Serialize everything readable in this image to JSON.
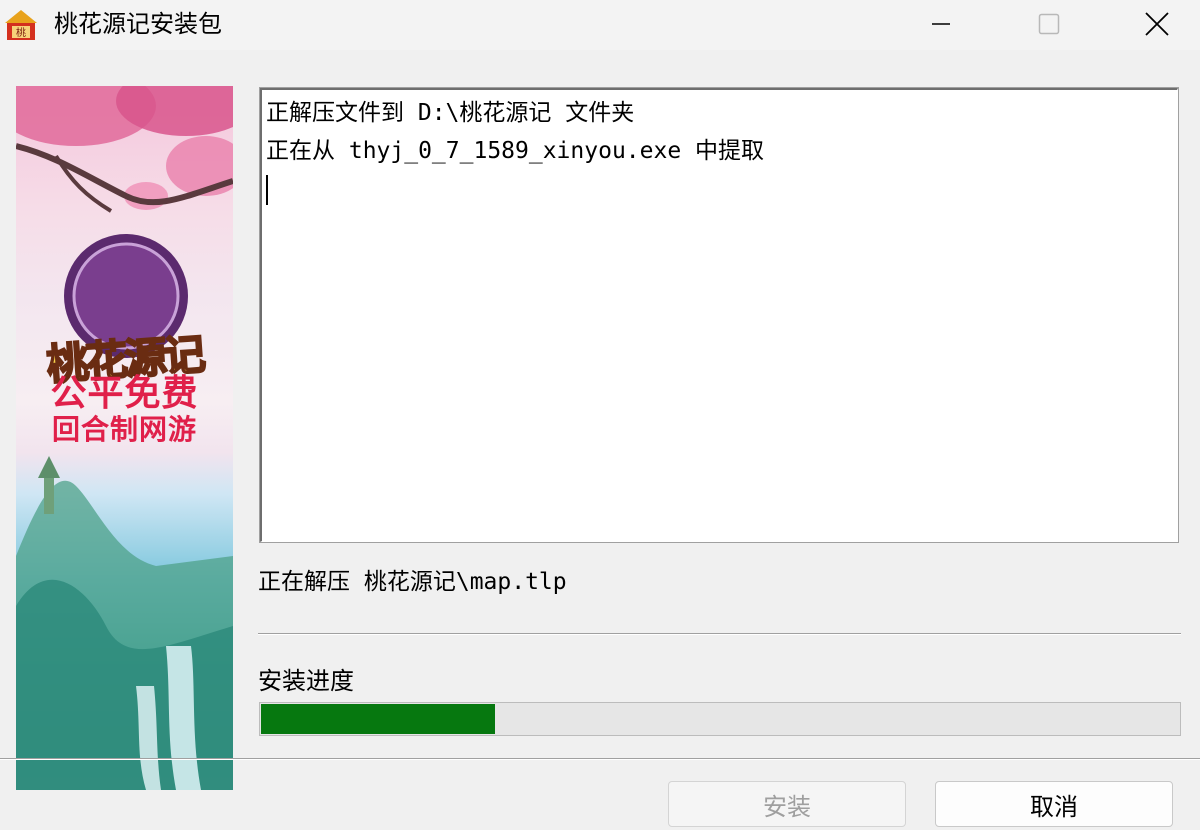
{
  "window": {
    "title": "桃花源记安装包",
    "app_icon": "peach-app-icon",
    "controls": [
      "minimize-icon",
      "maximize-icon",
      "close-icon"
    ]
  },
  "banner": {
    "logo_text": "桃花源记",
    "slogan_line1": "公平免费",
    "slogan_line2": "回合制网游"
  },
  "log": {
    "lines": [
      "正解压文件到 D:\\桃花源记 文件夹",
      "正在从 thyj_0_7_1589_xinyou.exe 中提取"
    ]
  },
  "status": {
    "current": "正在解压 桃花源记\\map.tlp"
  },
  "progress": {
    "label": "安装进度",
    "fraction": 0.255,
    "fill_color": "#06780f"
  },
  "buttons": {
    "install": "安装",
    "cancel": "取消"
  }
}
